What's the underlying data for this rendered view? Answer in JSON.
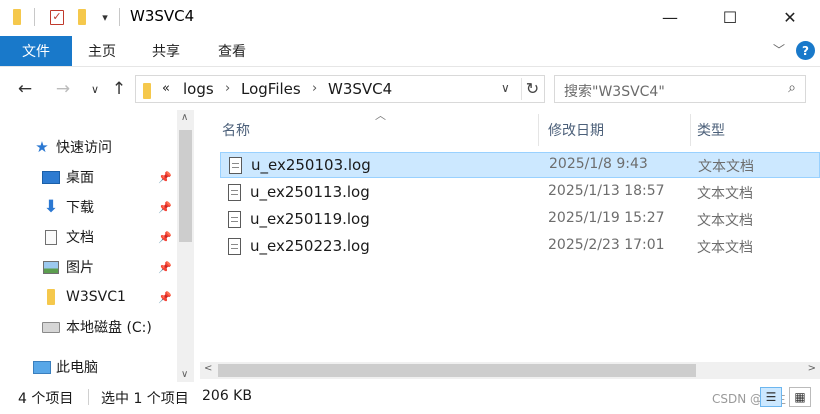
{
  "window": {
    "title": "W3SVC4",
    "minimize_glyph": "—",
    "maximize_glyph": "☐",
    "close_glyph": "✕"
  },
  "quick_access_toolbar": {
    "dropdown_glyph": "▾",
    "check_glyph": "✓"
  },
  "ribbon": {
    "tabs": [
      "文件",
      "主页",
      "共享",
      "查看"
    ],
    "help_label": "?",
    "collapse_glyph": "﹀"
  },
  "navigation": {
    "back_glyph": "←",
    "forward_glyph": "→",
    "recent_glyph": "∨",
    "up_glyph": "↑"
  },
  "address_bar": {
    "overflow": "«",
    "crumbs": [
      "logs",
      "LogFiles",
      "W3SVC4"
    ],
    "separator_glyph": "›",
    "dropdown_glyph": "∨",
    "refresh_glyph": "↻"
  },
  "search": {
    "placeholder": "搜索\"W3SVC4\"",
    "icon_glyph": "⌕"
  },
  "sidebar": {
    "items": [
      {
        "label": "快速访问",
        "icon": "star-icon",
        "pinned": false
      },
      {
        "label": "桌面",
        "icon": "desktop-icon",
        "pinned": true
      },
      {
        "label": "下载",
        "icon": "download-icon",
        "pinned": true
      },
      {
        "label": "文档",
        "icon": "document-icon",
        "pinned": true
      },
      {
        "label": "图片",
        "icon": "picture-icon",
        "pinned": true
      },
      {
        "label": "W3SVC1",
        "icon": "folder-icon",
        "pinned": true
      },
      {
        "label": "本地磁盘 (C:)",
        "icon": "drive-icon",
        "pinned": false
      },
      {
        "label": "此电脑",
        "icon": "computer-icon",
        "pinned": false
      }
    ],
    "pin_glyph": "📌",
    "scroll_up_glyph": "∧",
    "scroll_down_glyph": "∨",
    "star_glyph": "★",
    "download_glyph": "⬇"
  },
  "file_list": {
    "columns": [
      "名称",
      "修改日期",
      "类型"
    ],
    "sort_glyph": "︿",
    "rows": [
      {
        "name": "u_ex250103.log",
        "date": "2025/1/8 9:43",
        "type": "文本文档",
        "selected": true
      },
      {
        "name": "u_ex250113.log",
        "date": "2025/1/13 18:57",
        "type": "文本文档",
        "selected": false
      },
      {
        "name": "u_ex250119.log",
        "date": "2025/1/19 15:27",
        "type": "文本文档",
        "selected": false
      },
      {
        "name": "u_ex250223.log",
        "date": "2025/2/23 17:01",
        "type": "文本文档",
        "selected": false
      }
    ],
    "scroll_left_glyph": "<",
    "scroll_right_glyph": ">"
  },
  "status_bar": {
    "item_count": "4 个项目",
    "selection": "选中 1 个项目",
    "size": "206 KB",
    "watermark": "CSDN @汪主",
    "details_view_glyph": "☰",
    "icons_view_glyph": "▦"
  },
  "colors": {
    "accent": "#1979ca",
    "selection_bg": "#cce8ff",
    "selection_border": "#99d1ff",
    "folder": "#f5c84c"
  }
}
